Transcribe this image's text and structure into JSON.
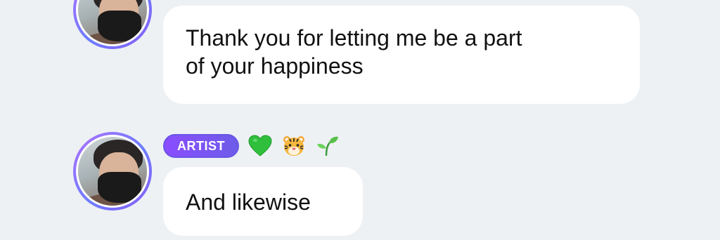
{
  "messages": [
    {
      "text": "Thank you for letting me be a part of your happiness",
      "line1": "Thank you for letting me be a part",
      "line2": "of your happiness"
    },
    {
      "text": "And likewise"
    }
  ],
  "sender": {
    "badge": "ARTIST",
    "status_emojis": [
      "green-heart",
      "tiger-face",
      "seedling"
    ]
  },
  "colors": {
    "background": "#eef1f4",
    "bubble": "#ffffff",
    "badge_start": "#8a4dff",
    "badge_end": "#6d5ce8",
    "avatar_ring": "#8b5cf6"
  }
}
